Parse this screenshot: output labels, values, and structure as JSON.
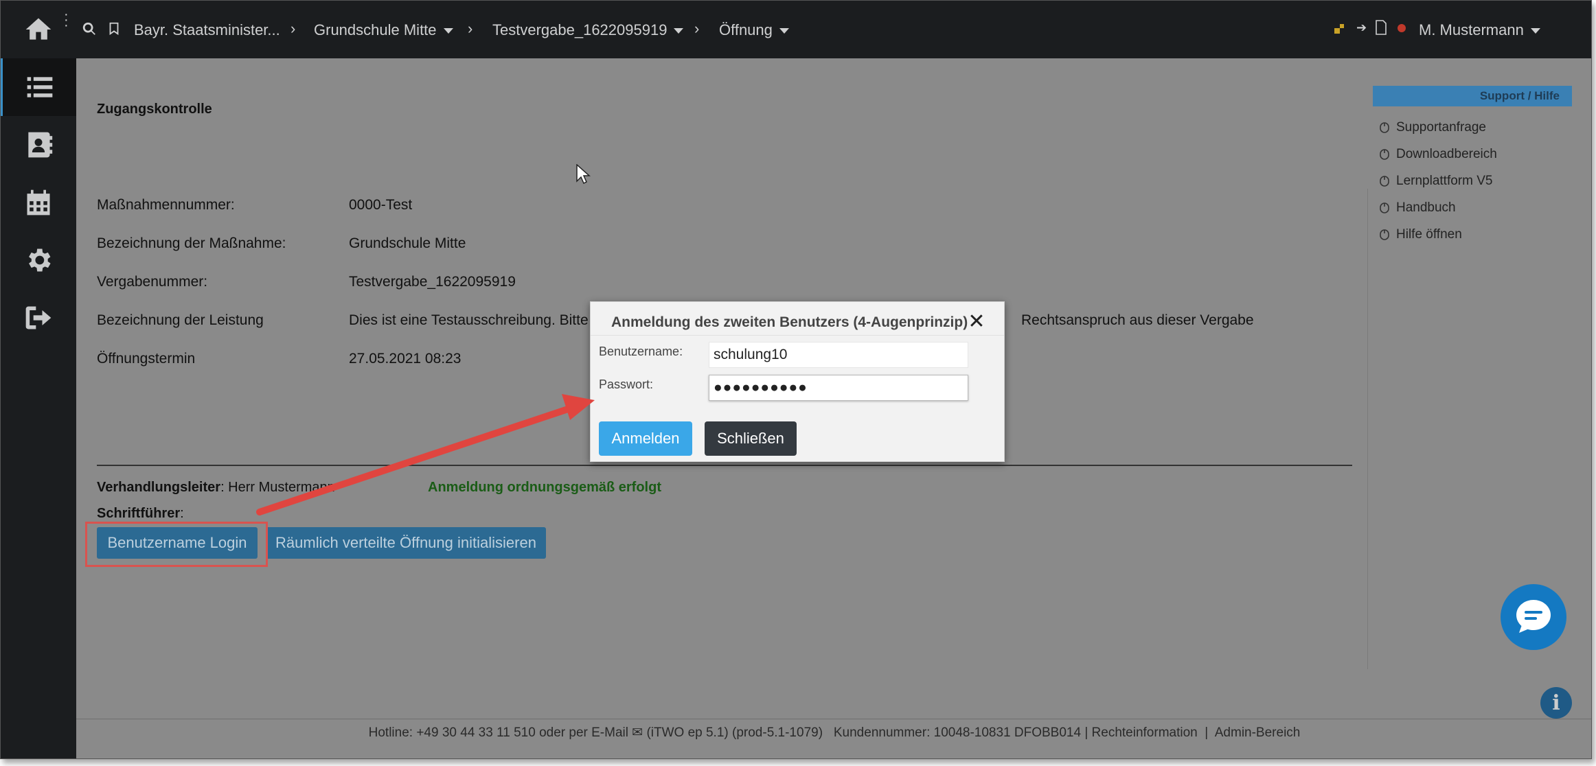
{
  "topbar": {
    "breadcrumbs": [
      {
        "label": "Bayr. Staatsminister...",
        "dropdown": false
      },
      {
        "label": "Grundschule Mitte",
        "dropdown": true
      },
      {
        "label": "Testvergabe_1622095919",
        "dropdown": true
      },
      {
        "label": "Öffnung",
        "dropdown": true
      }
    ],
    "user": "M. Mustermann"
  },
  "page": {
    "title": "Zugangskontrolle",
    "fields": [
      {
        "label": "Maßnahmennummer:",
        "value": "0000-Test"
      },
      {
        "label": "Bezeichnung der Maßnahme:",
        "value": "Grundschule Mitte"
      },
      {
        "label": "Vergabenummer:",
        "value": "Testvergabe_1622095919"
      },
      {
        "label": "Bezeichnung der Leistung",
        "value": "Dies ist eine Testausschreibung. Bitte",
        "value_tail": "Rechtsanspruch aus dieser Vergabe"
      },
      {
        "label": "Öffnungstermin",
        "value": "27.05.2021 08:23"
      }
    ],
    "verhandlungsleiter_label": "Verhandlungsleiter",
    "verhandlungsleiter_value": ": Herr Mustermann",
    "schriftfuehrer_label": "Schriftführer",
    "schriftfuehrer_value": ":",
    "success_message": "Anmeldung ordnungsgemäß erfolgt",
    "btn_login": "Benutzername Login",
    "btn_distributed": "Räumlich verteilte Öffnung initialisieren"
  },
  "help": {
    "header": "Support / Hilfe",
    "items": [
      "Supportanfrage",
      "Downloadbereich",
      "Lernplattform V5",
      "Handbuch",
      "Hilfe öffnen"
    ]
  },
  "footer": {
    "hotline": "Hotline: +49 30 44 33 11 510 oder per E-Mail",
    "version": "(iTWO ep 5.1) (prod-5.1-1079)",
    "customer": "Kundennummer: 10048-10831 DFOBB014 | Rechteinformation",
    "admin": "Admin-Bereich"
  },
  "modal": {
    "title": "Anmeldung des zweiten Benutzers (4-Augenprinzip)",
    "username_label": "Benutzername:",
    "username_value": "schulung10",
    "password_label": "Passwort:",
    "password_value": "●●●●●●●●●●",
    "btn_login": "Anmelden",
    "btn_close": "Schließen"
  },
  "colors": {
    "accent": "#3aa7e8",
    "dark_bar": "#1b1d1f",
    "annotation_red": "#e0453f",
    "success_green": "#1a5c16"
  }
}
